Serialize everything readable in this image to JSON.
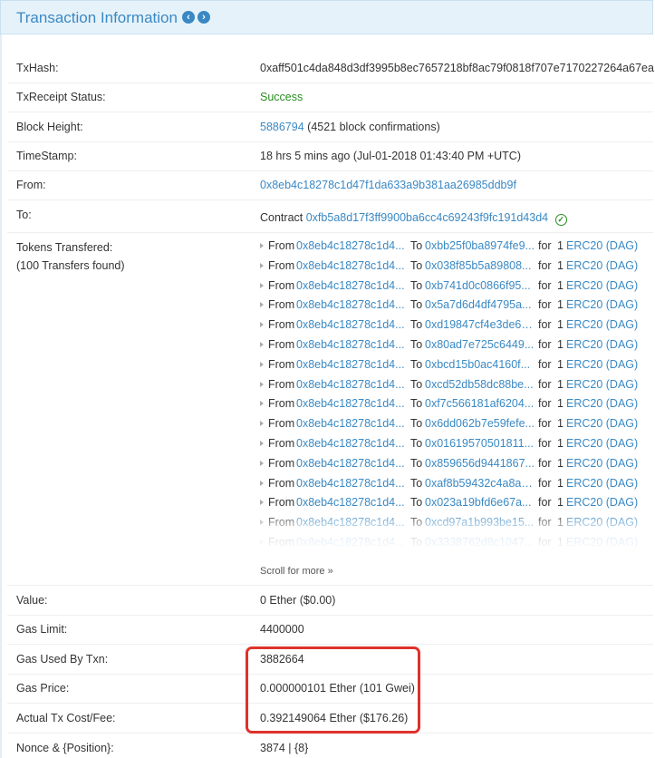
{
  "header": {
    "title": "Transaction Information",
    "prev_icon": "chevron-left-circle-icon",
    "next_icon": "chevron-right-circle-icon",
    "prev_glyph": "‹",
    "next_glyph": "›"
  },
  "fields": {
    "txhash": {
      "label": "TxHash:",
      "value": "0xaff501c4da848d3df3995b8ec7657218bf8ac79f0818f707e7170227264a67ea"
    },
    "receipt_status": {
      "label": "TxReceipt Status:",
      "value": "Success"
    },
    "block_height": {
      "label": "Block Height:",
      "block": "5886794",
      "confirmations": "(4521 block confirmations)"
    },
    "timestamp": {
      "label": "TimeStamp:",
      "value": "18 hrs 5 mins ago (Jul-01-2018 01:43:40 PM +UTC)"
    },
    "from": {
      "label": "From:",
      "value": "0x8eb4c18278c1d47f1da633a9b381aa26985ddb9f"
    },
    "to": {
      "label": "To:",
      "prefix": "Contract",
      "value": "0xfb5a8d17f3ff9900ba6cc4c69243f9fc191d43d4",
      "verified_icon": "check-circle-icon"
    },
    "tokens": {
      "label": "Tokens Transfered:",
      "sublabel": "(100 Transfers found)"
    },
    "value": {
      "label": "Value:",
      "value": "0 Ether ($0.00)"
    },
    "gas_limit": {
      "label": "Gas Limit:",
      "value": "4400000"
    },
    "gas_used": {
      "label": "Gas Used By Txn:",
      "value": "3882664"
    },
    "gas_price": {
      "label": "Gas Price:",
      "value": "0.000000101 Ether (101 Gwei)"
    },
    "tx_cost": {
      "label": "Actual Tx Cost/Fee:",
      "value": "0.392149064 Ether ($176.26)"
    },
    "nonce": {
      "label": "Nonce & {Position}:",
      "value": "3874 | {8}"
    }
  },
  "transfer_words": {
    "from": "From",
    "to": "To",
    "for": "for"
  },
  "transfers": [
    {
      "from": "0x8eb4c18278c1d4...",
      "to": "0xbb25f0ba8974fe9...",
      "amount": "1",
      "token": "ERC20 (DAG)"
    },
    {
      "from": "0x8eb4c18278c1d4...",
      "to": "0x038f85b5a89808...",
      "amount": "1",
      "token": "ERC20 (DAG)"
    },
    {
      "from": "0x8eb4c18278c1d4...",
      "to": "0xb741d0c0866f95...",
      "amount": "1",
      "token": "ERC20 (DAG)"
    },
    {
      "from": "0x8eb4c18278c1d4...",
      "to": "0x5a7d6d4df4795a...",
      "amount": "1",
      "token": "ERC20 (DAG)"
    },
    {
      "from": "0x8eb4c18278c1d4...",
      "to": "0xd19847cf4e3de6a...",
      "amount": "1",
      "token": "ERC20 (DAG)"
    },
    {
      "from": "0x8eb4c18278c1d4...",
      "to": "0x80ad7e725c6449...",
      "amount": "1",
      "token": "ERC20 (DAG)"
    },
    {
      "from": "0x8eb4c18278c1d4...",
      "to": "0xbcd15b0ac4160f...",
      "amount": "1",
      "token": "ERC20 (DAG)"
    },
    {
      "from": "0x8eb4c18278c1d4...",
      "to": "0xcd52db58dc88be...",
      "amount": "1",
      "token": "ERC20 (DAG)"
    },
    {
      "from": "0x8eb4c18278c1d4...",
      "to": "0xf7c566181af6204...",
      "amount": "1",
      "token": "ERC20 (DAG)"
    },
    {
      "from": "0x8eb4c18278c1d4...",
      "to": "0x6dd062b7e59fefe...",
      "amount": "1",
      "token": "ERC20 (DAG)"
    },
    {
      "from": "0x8eb4c18278c1d4...",
      "to": "0x01619570501811...",
      "amount": "1",
      "token": "ERC20 (DAG)"
    },
    {
      "from": "0x8eb4c18278c1d4...",
      "to": "0x859656d9441867...",
      "amount": "1",
      "token": "ERC20 (DAG)"
    },
    {
      "from": "0x8eb4c18278c1d4...",
      "to": "0xaf8b59432c4a8ac...",
      "amount": "1",
      "token": "ERC20 (DAG)"
    },
    {
      "from": "0x8eb4c18278c1d4...",
      "to": "0x023a19bfd6e67a...",
      "amount": "1",
      "token": "ERC20 (DAG)"
    },
    {
      "from": "0x8eb4c18278c1d4...",
      "to": "0xcd97a1b993be15...",
      "amount": "1",
      "token": "ERC20 (DAG)"
    },
    {
      "from": "0x8eb4c18278c1d4...",
      "to": "0x3338762d8c1047...",
      "amount": "1",
      "token": "ERC20 (DAG)"
    }
  ],
  "scroll_more": "Scroll for more",
  "scroll_more_icon": "double-chevron-down-icon",
  "colors": {
    "link": "#3a89c4",
    "success": "#2a8d22",
    "highlight": "#e0312b",
    "header_bg": "#e6f2fa"
  }
}
